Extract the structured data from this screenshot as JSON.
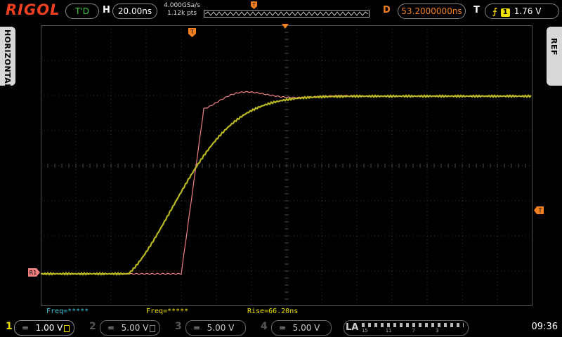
{
  "brand": "RIGOL",
  "status": {
    "trigger_state": "T'D",
    "h_label": "H",
    "timebase": "20.00ns",
    "sample_rate": "4.000GSa/s",
    "mem_depth": "1.12k pts",
    "d_label": "D",
    "delay": "53.2000000ns",
    "t_label": "T",
    "trigger_channel": "1",
    "trigger_level": "1.76 V"
  },
  "side_tabs": {
    "left": "HORIZONTAL",
    "right": "REF"
  },
  "markers": {
    "trigger": "T",
    "ref_marker": "R1"
  },
  "measurements": {
    "freq1": "Freq=*****",
    "freq2": "Freq=*****",
    "rise": "Rise=66.20ns"
  },
  "channels": [
    {
      "num": "1",
      "symbol": "=",
      "scale": "1.00 V",
      "active": true
    },
    {
      "num": "2",
      "symbol": "=",
      "scale": "5.00 V",
      "active": false
    },
    {
      "num": "3",
      "symbol": "=",
      "scale": "5.00 V",
      "active": false
    },
    {
      "num": "4",
      "symbol": "=",
      "scale": "5.00 V",
      "active": false
    }
  ],
  "la": {
    "label": "LA",
    "ticks": "15      11       7       3"
  },
  "clock": "09:36",
  "colors": {
    "ch1": "#b8b820",
    "ref": "#f08080",
    "trigger": "#f08020",
    "grid": "#3a3a3a",
    "measure_cyan": "#40c8e0",
    "measure_yellow": "#f0e000"
  }
}
